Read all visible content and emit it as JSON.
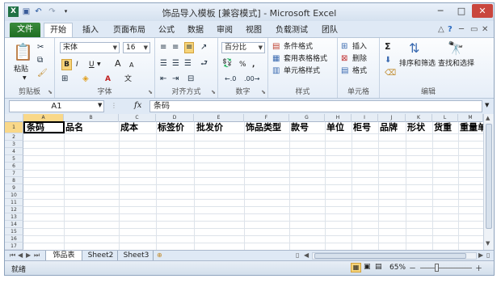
{
  "title_bar": {
    "title": "饰品导入模板  [兼容模式] - Microsoft Excel",
    "qat": [
      "excel-logo",
      "save",
      "undo",
      "redo"
    ],
    "minimize": "─",
    "maximize": "□",
    "close": "✕"
  },
  "tabs": {
    "file": "文件",
    "items": [
      "开始",
      "插入",
      "页面布局",
      "公式",
      "数据",
      "审阅",
      "视图",
      "负载测试",
      "团队"
    ],
    "active": "开始"
  },
  "ribbon": {
    "clipboard": {
      "label": "剪贴板",
      "paste": "粘贴"
    },
    "font": {
      "label": "字体",
      "name": "宋体",
      "size": "16",
      "bold": "B",
      "italic": "I",
      "underline": "U",
      "grow": "A",
      "shrink": "A",
      "wen": "文"
    },
    "alignment": {
      "label": "对齐方式"
    },
    "number": {
      "label": "数字",
      "format": "百分比",
      "percent": "%",
      "comma": ","
    },
    "styles": {
      "label": "样式",
      "items": [
        "条件格式",
        "套用表格格式",
        "单元格样式"
      ]
    },
    "cells": {
      "label": "单元格",
      "items": [
        "插入",
        "删除",
        "格式"
      ]
    },
    "editing": {
      "label": "编辑",
      "sort": "排序和筛选",
      "find": "查找和选择",
      "sigma": "Σ"
    }
  },
  "formula_bar": {
    "name_box": "A1",
    "fx": "fx",
    "content": "条码"
  },
  "columns": [
    "A",
    "B",
    "C",
    "D",
    "E",
    "F",
    "G",
    "H",
    "I",
    "J",
    "K",
    "L",
    "M"
  ],
  "rows": [
    "1",
    "2",
    "3",
    "4",
    "5",
    "6",
    "7",
    "8",
    "9",
    "10",
    "11",
    "12",
    "13",
    "14",
    "15",
    "16",
    "17",
    "18"
  ],
  "header_row": [
    "条码",
    "品名",
    "成本",
    "标签价",
    "批发价",
    "饰品类型",
    "款号",
    "单位",
    "柜号",
    "品牌",
    "形状",
    "货重",
    "重量单"
  ],
  "sheets": [
    "饰品表",
    "Sheet2",
    "Sheet3"
  ],
  "active_sheet": "饰品表",
  "status": {
    "ready": "就绪",
    "zoom": "65%",
    "minus": "－",
    "plus": "＋"
  }
}
